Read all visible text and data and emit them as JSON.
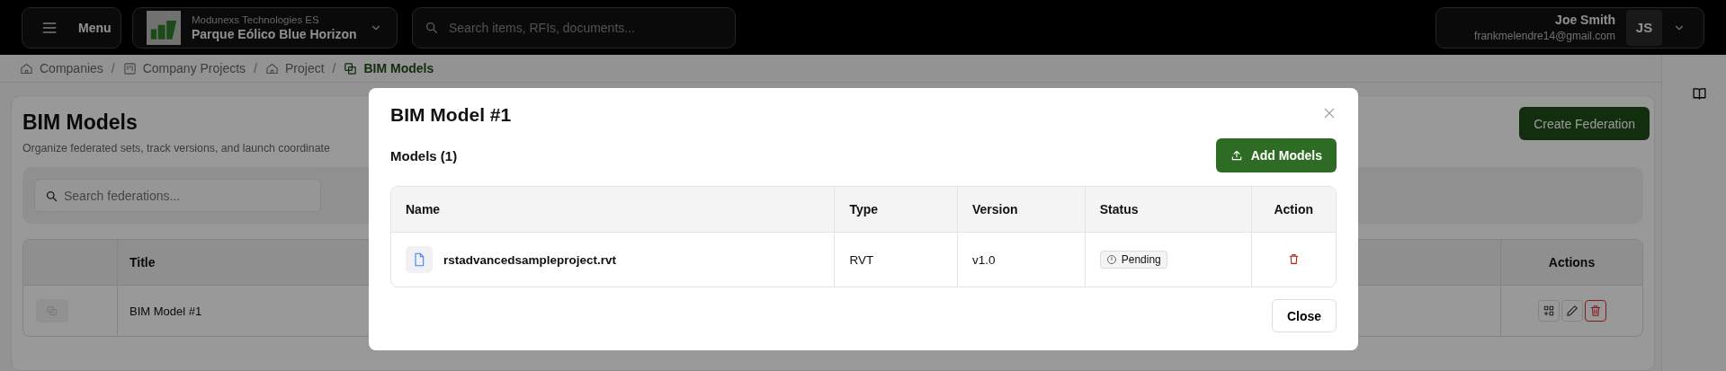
{
  "top_bar": {
    "menu_button": "Menu",
    "project": {
      "company": "Modunexs Technologies ES",
      "name": "Parque Eólico Blue Horizon"
    },
    "search": {
      "placeholder": "Search items, RFIs, documents..."
    },
    "user": {
      "name": "Joe Smith",
      "email": "frankmelendre14@gmail.com",
      "initials": "JS"
    }
  },
  "breadcrumbs": [
    {
      "label": "Companies",
      "kind": "home",
      "current": false,
      "separator": "/"
    },
    {
      "label": "Company Projects",
      "kind": "board",
      "current": false,
      "separator": "/"
    },
    {
      "label": "Project",
      "kind": "home",
      "current": false,
      "separator": "/"
    },
    {
      "label": "BIM Models",
      "kind": "layers",
      "current": true
    }
  ],
  "page": {
    "title": "BIM Models",
    "subtitle": "Organize federated sets, track versions, and launch coordinate",
    "create_button": "Create Federation",
    "search": {
      "placeholder": "Search federations..."
    },
    "table": {
      "columns": [
        "Title",
        "Actions"
      ],
      "rows": [
        {
          "title": "BIM Model #1"
        }
      ]
    }
  },
  "modal": {
    "title": "BIM Model #1",
    "section_title": "Models (1)",
    "add_button": "Add Models",
    "table": {
      "columns": [
        "Name",
        "Type",
        "Version",
        "Status",
        "Action"
      ],
      "rows": [
        {
          "name": "rstadvancedsampleproject.rvt",
          "type": "RVT",
          "version": "v1.0",
          "status": "Pending"
        }
      ]
    },
    "close_button": "Close"
  }
}
